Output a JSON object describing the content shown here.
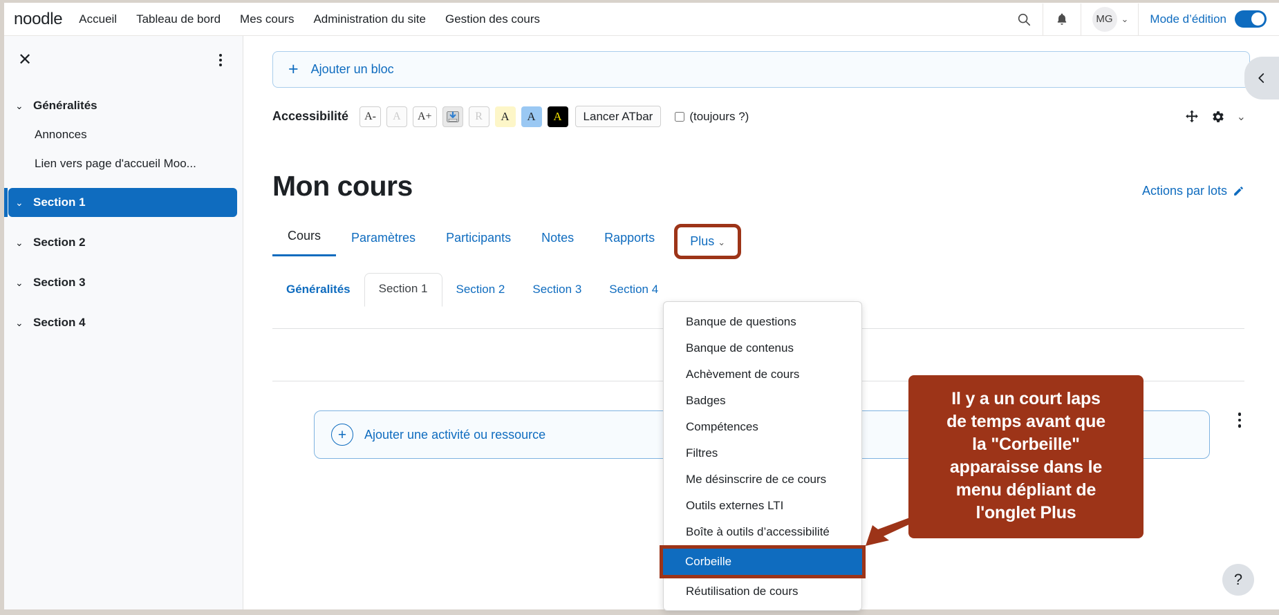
{
  "navbar": {
    "brand": "noodle",
    "links": [
      "Accueil",
      "Tableau de bord",
      "Mes cours",
      "Administration du site",
      "Gestion des cours"
    ],
    "search_icon": "search-icon",
    "notifications_icon": "bell-icon",
    "avatar_initials": "MG",
    "edit_mode_label": "Mode d’édition",
    "edit_mode_on": true
  },
  "drawer": {
    "close_label": "✕",
    "items": [
      {
        "label": "Généralités",
        "type": "section",
        "active": false
      },
      {
        "label": "Annonces",
        "type": "sub"
      },
      {
        "label": "Lien vers page d'accueil Moo...",
        "type": "sub"
      },
      {
        "label": "Section 1",
        "type": "section",
        "active": true
      },
      {
        "label": "Section 2",
        "type": "section",
        "active": false
      },
      {
        "label": "Section 3",
        "type": "section",
        "active": false
      },
      {
        "label": "Section 4",
        "type": "section",
        "active": false
      }
    ]
  },
  "add_block": {
    "label": "Ajouter un bloc",
    "icon": "plus-icon"
  },
  "accessibility": {
    "title": "Accessibilité",
    "decrease": "A-",
    "reset": "A",
    "increase": "A+",
    "image_icon": "image-toggle-icon",
    "readable": "R",
    "swatch_yellow": "A",
    "swatch_blue": "A",
    "swatch_black": "A",
    "launch_atbar": "Lancer ATbar",
    "always_label": "(toujours ?)",
    "always_checked": false,
    "move_icon": "move-icon",
    "gear_icon": "gear-icon",
    "chevron_icon": "chevron-down-icon"
  },
  "page": {
    "title": "Mon cours",
    "bulk_actions": "Actions par lots",
    "bulk_icon": "pencil-icon"
  },
  "primary_tabs": [
    {
      "label": "Cours",
      "active": true,
      "boxed": false
    },
    {
      "label": "Paramètres",
      "active": false,
      "boxed": false
    },
    {
      "label": "Participants",
      "active": false,
      "boxed": false
    },
    {
      "label": "Notes",
      "active": false,
      "boxed": false
    },
    {
      "label": "Rapports",
      "active": false,
      "boxed": false
    },
    {
      "label": "Plus",
      "active": false,
      "boxed": true,
      "chevron": "⌄"
    }
  ],
  "section_tabs": [
    {
      "label": "Généralités",
      "selected": false,
      "bold": true
    },
    {
      "label": "Section 1",
      "selected": true,
      "bold": false
    },
    {
      "label": "Section 2",
      "selected": false,
      "bold": false
    },
    {
      "label": "Section 3",
      "selected": false,
      "bold": false
    },
    {
      "label": "Section 4",
      "selected": false,
      "bold": false
    }
  ],
  "add_activity": {
    "label": "Ajouter une activité ou ressource",
    "icon": "plus-circle-icon"
  },
  "dropdown": {
    "items": [
      {
        "label": "Banque de questions",
        "highlighted": false
      },
      {
        "label": "Banque de contenus",
        "highlighted": false
      },
      {
        "label": "Achèvement de cours",
        "highlighted": false
      },
      {
        "label": "Badges",
        "highlighted": false
      },
      {
        "label": "Compétences",
        "highlighted": false
      },
      {
        "label": "Filtres",
        "highlighted": false
      },
      {
        "label": "Me désinscrire de ce cours",
        "highlighted": false
      },
      {
        "label": "Outils externes LTI",
        "highlighted": false
      },
      {
        "label": "Boîte à outils d’accessibilité",
        "highlighted": false
      },
      {
        "label": "Corbeille",
        "highlighted": true
      },
      {
        "label": "Réutilisation de cours",
        "highlighted": false
      }
    ]
  },
  "callout": {
    "lines": [
      "Il y a un court laps",
      "de temps avant que",
      "la \"Corbeille\"",
      "apparaisse dans le",
      "menu dépliant de",
      "l'onglet Plus"
    ],
    "text": "Il y a un court laps de temps avant que la \"Corbeille\" apparaisse dans le menu dépliant de l'onglet Plus"
  },
  "right_panel_toggle": {
    "icon": "chevron-left-icon"
  },
  "help_button": {
    "label": "?"
  },
  "colors": {
    "accent_blue": "#0f6cbf",
    "annotation_red": "#9d3418",
    "drawer_bg": "#f8f9fb",
    "highlight_blue": "#0f6cbf"
  }
}
